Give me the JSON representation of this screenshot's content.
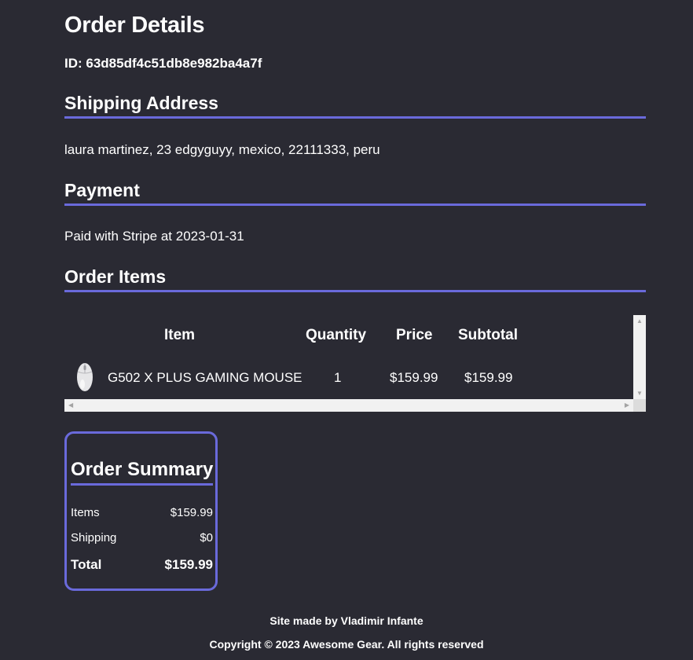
{
  "order": {
    "title": "Order Details",
    "id_text": "ID: 63d85df4c51db8e982ba4a7f"
  },
  "shipping": {
    "heading": "Shipping Address",
    "address": "laura martinez, 23 edgyguyy, mexico, 22111333, peru"
  },
  "payment": {
    "heading": "Payment",
    "status": "Paid with Stripe at 2023-01-31"
  },
  "items": {
    "heading": "Order Items",
    "columns": [
      "Item",
      "Quantity",
      "Price",
      "Subtotal"
    ],
    "rows": [
      {
        "name": "G502 X PLUS GAMING MOUSE",
        "quantity": "1",
        "price": "$159.99",
        "subtotal": "$159.99",
        "icon": "gaming-mouse-image"
      }
    ]
  },
  "summary": {
    "title": "Order Summary",
    "items_label": "Items",
    "items_value": "$159.99",
    "shipping_label": "Shipping",
    "shipping_value": "$0",
    "total_label": "Total",
    "total_value": "$159.99"
  },
  "footer": {
    "credit": "Site made by Vladimir Infante",
    "copyright": "Copyright © 2023 Awesome Gear. All rights reserved"
  },
  "colors": {
    "background": "#2a2a33",
    "accent": "#6a6adb",
    "text": "#ffffff"
  }
}
